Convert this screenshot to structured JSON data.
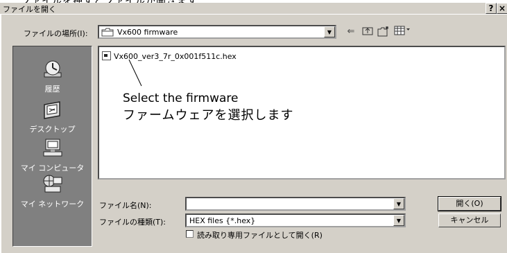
{
  "top_snippet": "ファイルを押すとファイルが開きます",
  "dialog": {
    "title": "ファイルを開く",
    "help": "?",
    "close": "×"
  },
  "lookin": {
    "label": "ファイルの場所(I):",
    "value": "Vx600 firmware"
  },
  "places": [
    {
      "label": "履歴",
      "icon": "history-icon"
    },
    {
      "label": "デスクトップ",
      "icon": "desktop-icon"
    },
    {
      "label": "マイ コンピュータ",
      "icon": "my-computer-icon"
    },
    {
      "label": "マイ ネットワーク",
      "icon": "my-network-icon"
    }
  ],
  "files": [
    {
      "name": "Vx600_ver3_7r_0x001f511c.hex",
      "icon": "hex-file-icon"
    }
  ],
  "callout": {
    "en": "Select the firmware",
    "ja": "ファームウェアを選択します"
  },
  "filename": {
    "label": "ファイル名(N):",
    "value": ""
  },
  "filetype": {
    "label": "ファイルの種類(T):",
    "value": "HEX files {*.hex}"
  },
  "buttons": {
    "open": "開く(O)",
    "cancel": "キャンセル"
  },
  "readonly": {
    "label": "読み取り専用ファイルとして開く(R)",
    "checked": false
  }
}
